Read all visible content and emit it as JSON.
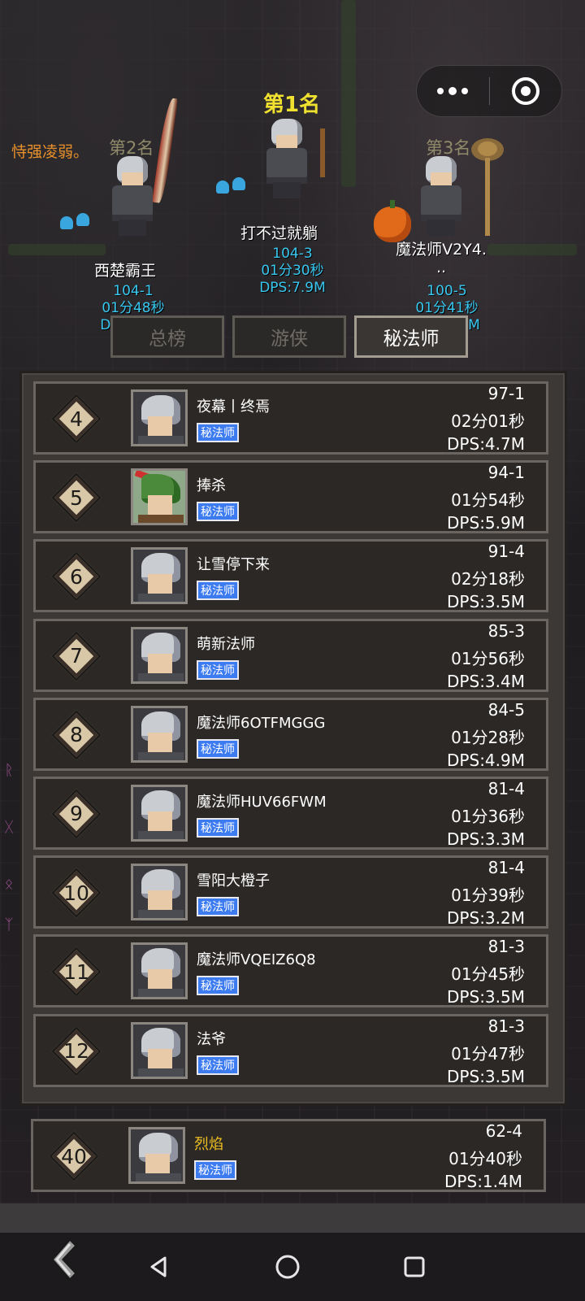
{
  "header": {
    "motto": "恃强凌弱。",
    "capsule_icons": [
      "more-dots-icon",
      "target-icon"
    ]
  },
  "podium": {
    "first": {
      "label": "第1名",
      "name": "打不过就躺",
      "level": "104-3",
      "time": "01分30秒",
      "dps": "DPS:7.9M"
    },
    "second": {
      "label": "第2名",
      "name": "西楚霸王",
      "level": "104-1",
      "time": "01分48秒",
      "dps": "DPS:7.7M"
    },
    "third": {
      "label": "第3名",
      "name_line1": "魔法师V2Y4.",
      "name_line2": "..",
      "level": "100-5",
      "time": "01分41秒",
      "dps": "DPS:8.6M"
    }
  },
  "tabs": [
    {
      "label": "总榜",
      "active": false
    },
    {
      "label": "游侠",
      "active": false
    },
    {
      "label": "秘法师",
      "active": true
    }
  ],
  "rankings": [
    {
      "rank": "4",
      "name": "夜幕丨终焉",
      "class": "秘法师",
      "level": "97-1",
      "time": "02分01秒",
      "dps": "DPS:4.7M",
      "avatar": "mage"
    },
    {
      "rank": "5",
      "name": "捧杀",
      "class": "秘法师",
      "level": "94-1",
      "time": "01分54秒",
      "dps": "DPS:5.9M",
      "avatar": "ranger"
    },
    {
      "rank": "6",
      "name": "让雪停下来",
      "class": "秘法师",
      "level": "91-4",
      "time": "02分18秒",
      "dps": "DPS:3.5M",
      "avatar": "mage"
    },
    {
      "rank": "7",
      "name": "萌新法师",
      "class": "秘法师",
      "level": "85-3",
      "time": "01分56秒",
      "dps": "DPS:3.4M",
      "avatar": "mage"
    },
    {
      "rank": "8",
      "name": "魔法师6OTFMGGG",
      "class": "秘法师",
      "level": "84-5",
      "time": "01分28秒",
      "dps": "DPS:4.9M",
      "avatar": "mage"
    },
    {
      "rank": "9",
      "name": "魔法师HUV66FWM",
      "class": "秘法师",
      "level": "81-4",
      "time": "01分36秒",
      "dps": "DPS:3.3M",
      "avatar": "mage"
    },
    {
      "rank": "10",
      "name": "雪阳大橙子",
      "class": "秘法师",
      "level": "81-4",
      "time": "01分39秒",
      "dps": "DPS:3.2M",
      "avatar": "mage"
    },
    {
      "rank": "11",
      "name": "魔法师VQEIZ6Q8",
      "class": "秘法师",
      "level": "81-3",
      "time": "01分45秒",
      "dps": "DPS:3.5M",
      "avatar": "mage"
    },
    {
      "rank": "12",
      "name": "法爷",
      "class": "秘法师",
      "level": "81-3",
      "time": "01分47秒",
      "dps": "DPS:3.5M",
      "avatar": "mage"
    }
  ],
  "self": {
    "rank": "40",
    "name": "烈焰",
    "class": "秘法师",
    "level": "62-4",
    "time": "01分40秒",
    "dps": "DPS:1.4M",
    "avatar": "mage"
  },
  "colors": {
    "name_highlight": "#f0c020",
    "stat_cyan": "#38c8f0",
    "first_place": "#f0e030",
    "class_badge": "#3d7bf0",
    "motto": "#e8902a"
  },
  "navbar": {
    "icons": [
      "back-triangle-icon",
      "home-circle-icon",
      "recents-square-icon"
    ]
  }
}
